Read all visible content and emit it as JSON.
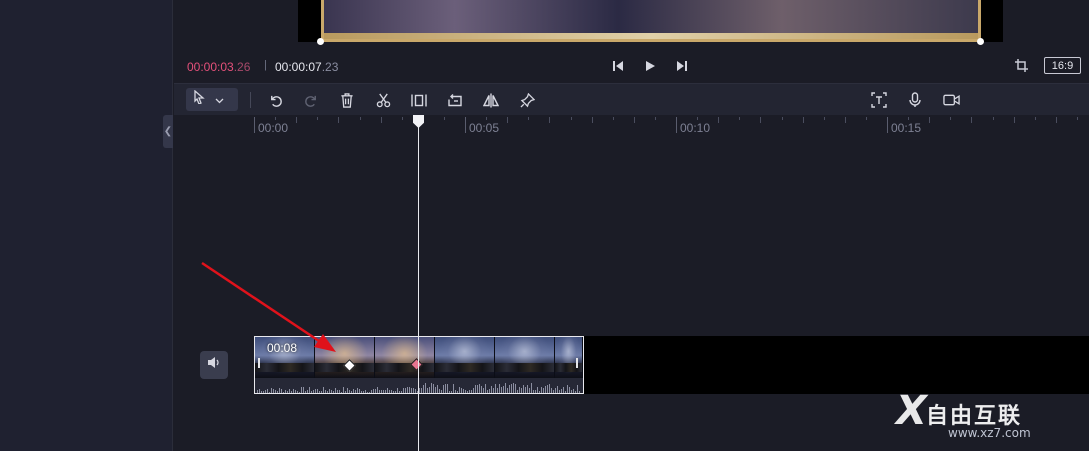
{
  "playback": {
    "current_time_main": "00:00:03",
    "current_time_frac": ".26",
    "separator": "|",
    "total_time_main": "00:00:07",
    "total_time_frac": ".23",
    "aspect_ratio": "16:9",
    "icons": [
      "skip-back-icon",
      "play-icon",
      "skip-forward-icon",
      "crop-icon"
    ]
  },
  "toolbar": {
    "select_tool_icon": "pointer-icon",
    "tools": [
      "undo-icon",
      "redo-icon",
      "delete-icon",
      "split-icon",
      "freeze-icon",
      "reverse-icon",
      "mirror-icon",
      "marker-icon"
    ],
    "right_tools": [
      "text-to-speech-icon",
      "microphone-icon",
      "record-camera-icon"
    ]
  },
  "timeline": {
    "ruler_labels": [
      "00:00",
      "00:05",
      "00:10",
      "00:15"
    ],
    "clip": {
      "duration_label": "00:08"
    }
  },
  "colors": {
    "accent_pink": "#e4507a",
    "annotation_arrow": "#e0121b",
    "keyframe_active": "#e8738f"
  },
  "watermark": {
    "logo_text": "X",
    "name": "自由互联",
    "url": "www.xz7.com"
  }
}
